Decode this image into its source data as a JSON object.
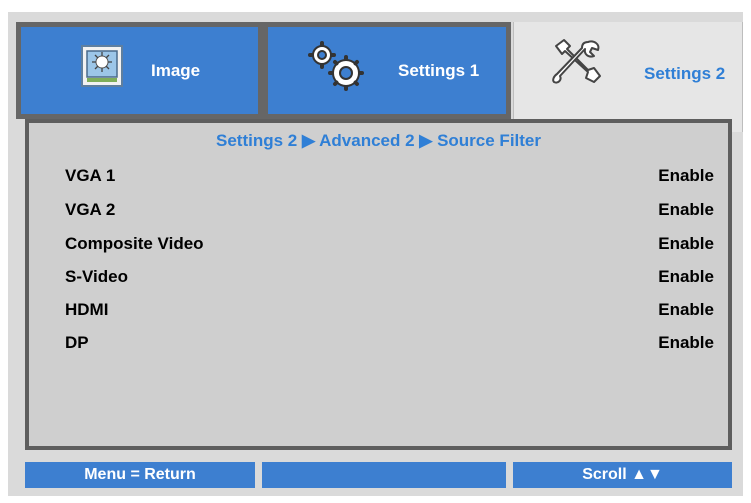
{
  "tabs": [
    {
      "label": "Image",
      "icon": "image-icon",
      "active": false
    },
    {
      "label": "Settings 1",
      "icon": "gears-icon",
      "active": false
    },
    {
      "label": "Settings 2",
      "icon": "tools-icon",
      "active": true
    }
  ],
  "breadcrumb": "Settings 2 ▶ Advanced 2 ▶ Source Filter",
  "items": [
    {
      "label": "VGA 1",
      "value": "Enable"
    },
    {
      "label": "VGA 2",
      "value": "Enable"
    },
    {
      "label": "Composite Video",
      "value": "Enable"
    },
    {
      "label": "S-Video",
      "value": "Enable"
    },
    {
      "label": "HDMI",
      "value": "Enable"
    },
    {
      "label": "DP",
      "value": "Enable"
    }
  ],
  "footer": {
    "left": "Menu = Return",
    "middle": "",
    "right": "Scroll ▲▼"
  },
  "colors": {
    "accent_blue": "#3d7fd0",
    "text_blue": "#2f7fd6",
    "panel_gray": "#cfcfcf",
    "frame_gray": "#dadada",
    "border_gray": "#5e5e5e"
  }
}
